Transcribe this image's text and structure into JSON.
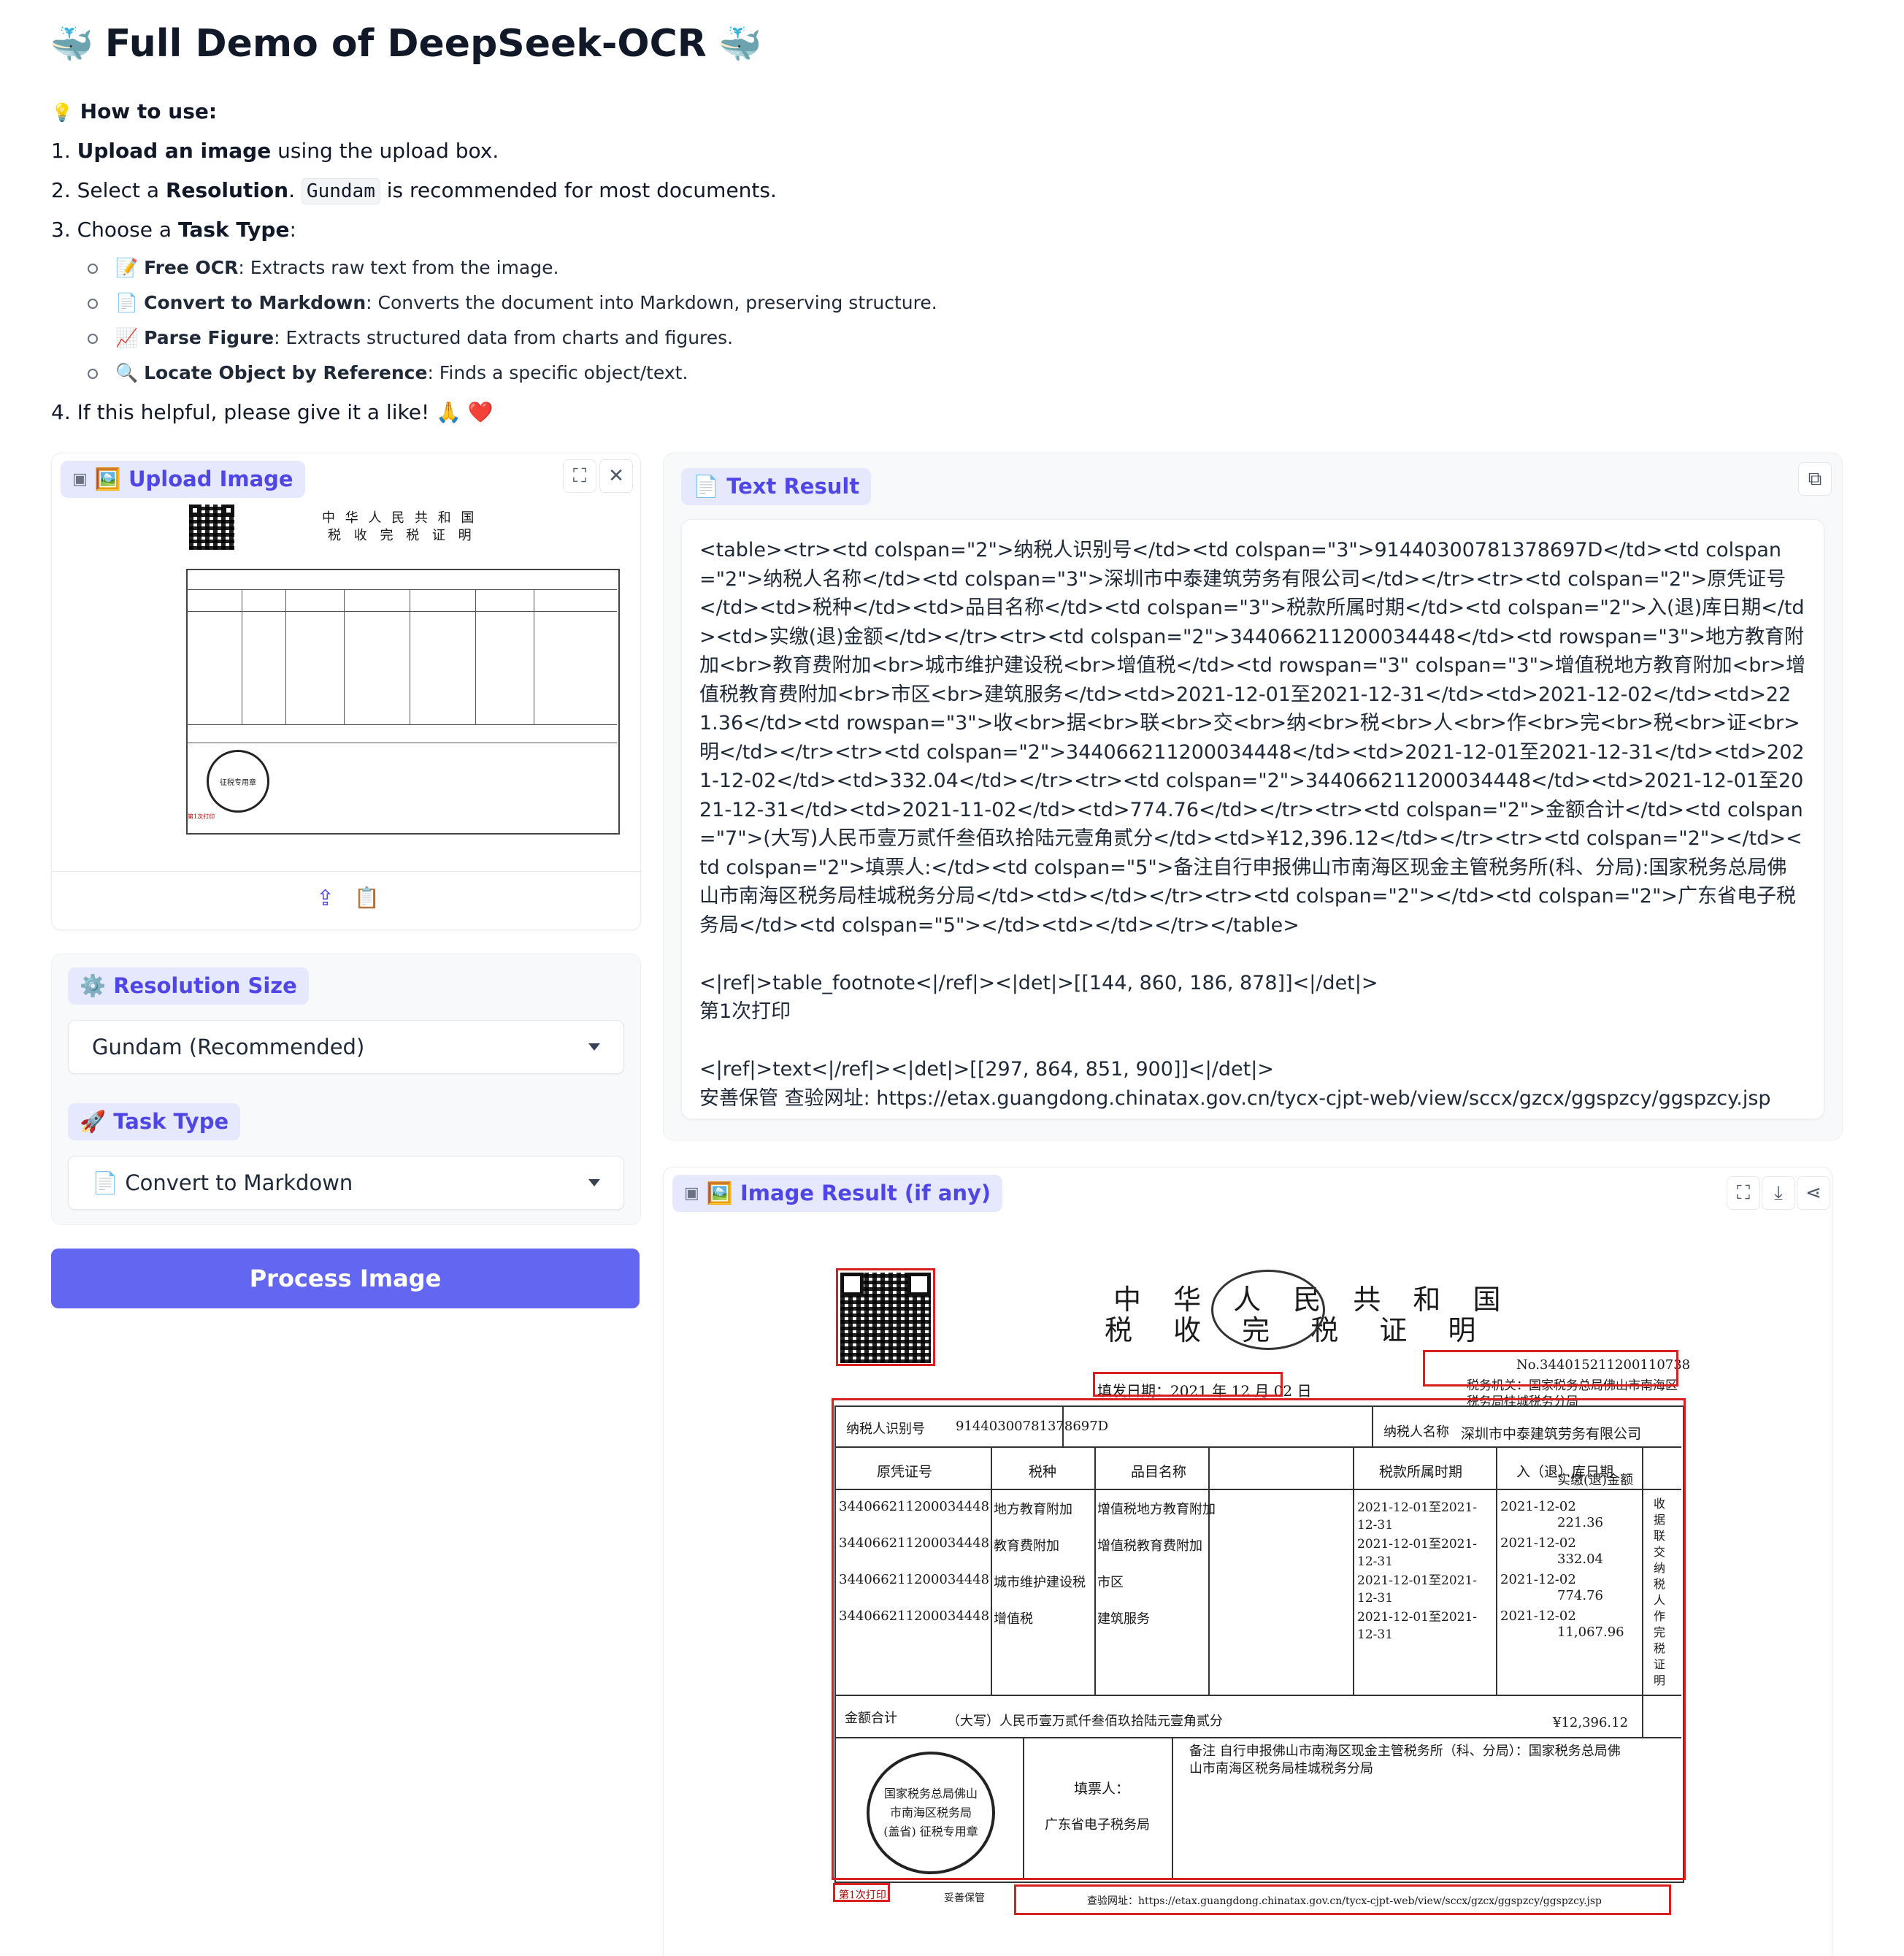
{
  "header": {
    "title": "Full Demo of DeepSeek-OCR",
    "title_emoji": "🐳",
    "howto_icon": "💡",
    "howto_label": "How to use:",
    "steps": [
      {
        "num": "1.",
        "bold": "Upload an image",
        "rest": " using the upload box."
      },
      {
        "num": "2.",
        "pre": "Select a ",
        "bold": "Resolution",
        "mid": ". ",
        "code": "Gundam",
        "rest": " is recommended for most documents."
      },
      {
        "num": "3.",
        "pre": "Choose a ",
        "bold": "Task Type",
        "rest": ":"
      },
      {
        "num": "4.",
        "rest": "If this helpful, please give it a like! 🙏 ❤️"
      }
    ],
    "task_types": [
      {
        "icon": "📝",
        "bold": "Free OCR",
        "rest": ": Extracts raw text from the image."
      },
      {
        "icon": "📄",
        "bold": "Convert to Markdown",
        "rest": ": Converts the document into Markdown, preserving structure."
      },
      {
        "icon": "📈",
        "bold": "Parse Figure",
        "rest": ": Extracts structured data from charts and figures."
      },
      {
        "icon": "🔍",
        "bold": "Locate Object by Reference",
        "rest": ": Finds a specific object/text."
      }
    ]
  },
  "upload": {
    "label": "🖼️ Upload Image"
  },
  "settings": {
    "resolution_label": "⚙️ Resolution Size",
    "resolution_value": "Gundam (Recommended)",
    "task_label": "🚀 Task Type",
    "task_value": "📄 Convert to Markdown",
    "process_label": "Process Image"
  },
  "text_result": {
    "label": "📄 Text Result",
    "content": "<table><tr><td colspan=\"2\">纳税人识别号</td><td colspan=\"3\">91440300781378697D</td><td colspan=\"2\">纳税人名称</td><td colspan=\"3\">深圳市中泰建筑劳务有限公司</td></tr><tr><td colspan=\"2\">原凭证号</td><td>税种</td><td>品目名称</td><td colspan=\"3\">税款所属时期</td><td colspan=\"2\">入(退)库日期</td><td>实缴(退)金额</td></tr><tr><td colspan=\"2\">344066211200034448</td><td rowspan=\"3\">地方教育附加<br>教育费附加<br>城市维护建设税<br>增值税</td><td rowspan=\"3\" colspan=\"3\">增值税地方教育附加<br>增值税教育费附加<br>市区<br>建筑服务</td><td>2021-12-01至2021-12-31</td><td>2021-12-02</td><td>221.36</td><td rowspan=\"3\">收<br>据<br>联<br>交<br>纳<br>税<br>人<br>作<br>完<br>税<br>证<br>明</td></tr><tr><td colspan=\"2\">344066211200034448</td><td>2021-12-01至2021-12-31</td><td>2021-12-02</td><td>332.04</td></tr><tr><td colspan=\"2\">344066211200034448</td><td>2021-12-01至2021-12-31</td><td>2021-11-02</td><td>774.76</td></tr><tr><td colspan=\"2\">金额合计</td><td colspan=\"7\">(大写)人民币壹万贰仟叁佰玖拾陆元壹角贰分</td><td>¥12,396.12</td></tr><tr><td colspan=\"2\"></td><td colspan=\"2\">填票人:</td><td colspan=\"5\">备注自行申报佛山市南海区现金主管税务所(科、分局):国家税务总局佛山市南海区税务局桂城税务分局</td><td></td></tr><tr><td colspan=\"2\"></td><td colspan=\"2\">广东省电子税务局</td><td colspan=\"5\"></td><td></td></tr></table>\n\n<|ref|>table_footnote<|/ref|><|det|>[[144, 860, 186, 878]]<|/det|>\n第1次打印\n\n<|ref|>text<|/ref|><|det|>[[297, 864, 851, 900]]<|/det|>\n安善保管 查验网址: https://etax.guangdong.chinatax.gov.cn/tycx-cjpt-web/view/sccx/gzcx/ggspzcy/ggspzcy.jsp"
  },
  "image_result": {
    "label": "🖼️ Image Result (if any)"
  },
  "document": {
    "title_line1": "中 华 人 民 共 和 国",
    "title_line2": "税 收 完 税 证 明",
    "number": "No.344015211200110738",
    "fill_date": "填发日期：2021 年 12 月 02 日",
    "tax_office": "税务机关：国家税务总局佛山市南海区税务局桂城税务分局",
    "taxpayer_id_label": "纳税人识别号",
    "taxpayer_id": "91440300781378697D",
    "taxpayer_name_label": "纳税人名称",
    "taxpayer_name": "深圳市中泰建筑劳务有限公司",
    "col_headers": [
      "原凭证号",
      "税种",
      "品目名称",
      "税款所属时期",
      "入（退）库日期",
      "实缴(退)金额"
    ],
    "rows": [
      {
        "voucher": "344066211200034448",
        "tax": "地方教育附加",
        "item": "增值税地方教育附加",
        "period": "2021-12-01至2021-12-31",
        "date": "2021-12-02",
        "amount": "221.36"
      },
      {
        "voucher": "344066211200034448",
        "tax": "教育费附加",
        "item": "增值税教育费附加",
        "period": "2021-12-01至2021-12-31",
        "date": "2021-12-02",
        "amount": "332.04"
      },
      {
        "voucher": "344066211200034448",
        "tax": "城市维护建设税",
        "item": "市区",
        "period": "2021-12-01至2021-12-31",
        "date": "2021-12-02",
        "amount": "774.76"
      },
      {
        "voucher": "344066211200034448",
        "tax": "增值税",
        "item": "建筑服务",
        "period": "2021-12-01至2021-12-31",
        "date": "2021-12-02",
        "amount": "11,067.96"
      }
    ],
    "total_label": "金额合计",
    "total_words": "（大写）人民币壹万贰仟叁佰玖拾陆元壹角贰分",
    "total_amount": "¥12,396.12",
    "filler_label": "填票人：",
    "filler": "广东省电子税务局",
    "remark": "备注  自行申报佛山市南海区现金主管税务所（科、分局）：国家税务总局佛山市南海区税务局桂城税务分局",
    "side_text": "收据联  交纳税人作完税证明",
    "seal_text": "国家税务总局佛山市南海区税务局 (盖省) 征税专用章",
    "footnote": "第1次打印",
    "keep": "妥善保管",
    "verify_url": "查验网址：https://etax.guangdong.chinatax.gov.cn/tycx-cjpt-web/view/sccx/gzcx/ggspzcy/ggspzcy.jsp"
  }
}
